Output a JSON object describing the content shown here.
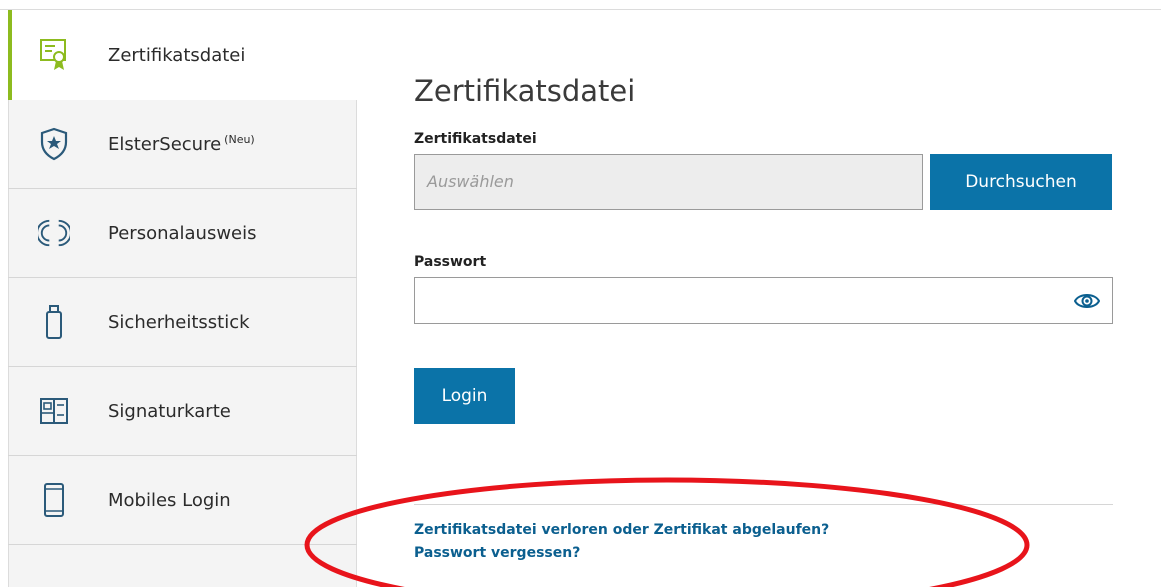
{
  "sidebar": {
    "items": [
      {
        "label": "Zertifikatsdatei",
        "icon": "certificate-file-icon",
        "active": true
      },
      {
        "label": "ElsterSecure",
        "badge": "(Neu)",
        "icon": "shield-star-icon",
        "active": false
      },
      {
        "label": "Personalausweis",
        "icon": "id-card-circle-icon",
        "active": false
      },
      {
        "label": "Sicherheitsstick",
        "icon": "usb-stick-icon",
        "active": false
      },
      {
        "label": "Signaturkarte",
        "icon": "signature-card-icon",
        "active": false
      },
      {
        "label": "Mobiles Login",
        "icon": "mobile-phone-icon",
        "active": false
      }
    ],
    "accent_color": "#8dbb1f"
  },
  "main": {
    "title": "Zertifikatsdatei",
    "file_field": {
      "label": "Zertifikatsdatei",
      "placeholder": "Auswählen",
      "browse_label": "Durchsuchen"
    },
    "password_field": {
      "label": "Passwort",
      "value": "",
      "toggle_icon": "eye-icon"
    },
    "login_label": "Login",
    "links": {
      "lost_certificate": "Zertifikatsdatei verloren oder Zertifikat abgelaufen?",
      "forgot_password": "Passwort vergessen?"
    },
    "button_color": "#0b73a8",
    "annotation_color": "#e8141b"
  }
}
